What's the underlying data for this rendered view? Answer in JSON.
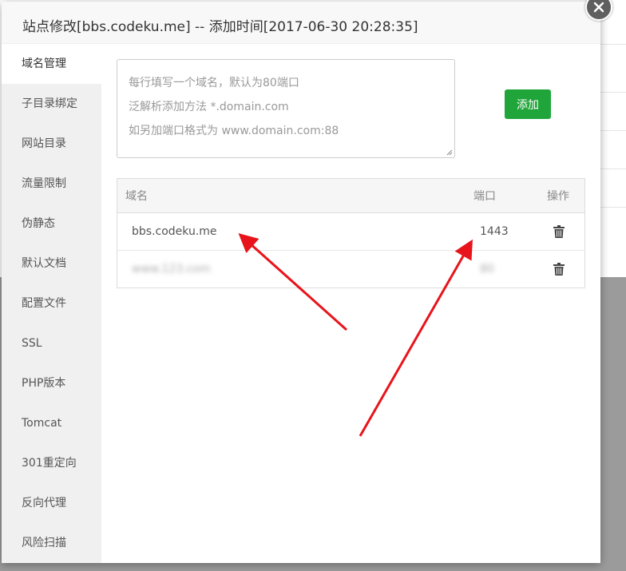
{
  "dialog": {
    "title": "站点修改[bbs.codeku.me] -- 添加时间[2017-06-30 20:28:35]",
    "close_icon": "close-icon"
  },
  "sidebar": {
    "items": [
      {
        "label": "域名管理",
        "active": true
      },
      {
        "label": "子目录绑定"
      },
      {
        "label": "网站目录"
      },
      {
        "label": "流量限制"
      },
      {
        "label": "伪静态"
      },
      {
        "label": "默认文档"
      },
      {
        "label": "配置文件"
      },
      {
        "label": "SSL"
      },
      {
        "label": "PHP版本"
      },
      {
        "label": "Tomcat"
      },
      {
        "label": "301重定向"
      },
      {
        "label": "反向代理"
      },
      {
        "label": "风险扫描"
      }
    ]
  },
  "domain_input": {
    "placeholder_lines": [
      "每行填写一个域名，默认为80端口",
      "泛解析添加方法 *.domain.com",
      "如另加端口格式为 www.domain.com:88"
    ]
  },
  "add_button": {
    "label": "添加"
  },
  "domain_table": {
    "headers": {
      "domain": "域名",
      "port": "端口",
      "actions": "操作"
    },
    "rows": [
      {
        "domain": "bbs.codeku.me",
        "port": "1443"
      },
      {
        "domain": "www.123.com",
        "port": "80",
        "blurred": true
      }
    ]
  },
  "colors": {
    "accent_green": "#20a53a",
    "annotation_red": "#e8141b",
    "sidebar_bg": "#f0f0f0"
  }
}
